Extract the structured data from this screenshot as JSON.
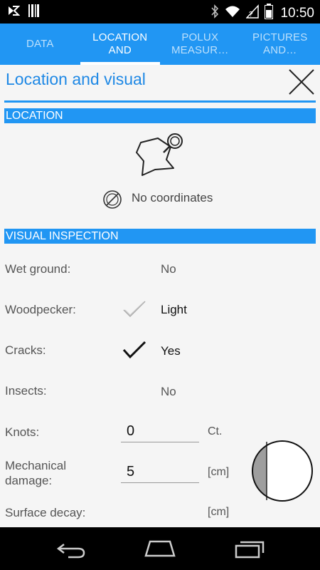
{
  "status_bar": {
    "time": "10:50",
    "left_icons": [
      "app-notification-icon",
      "barcode-icon"
    ],
    "right_icons": [
      "bluetooth-icon",
      "wifi-icon",
      "signal-icon",
      "battery-icon"
    ]
  },
  "tabs": [
    {
      "label": "DATA",
      "active": false
    },
    {
      "label": "LOCATION AND",
      "active": true
    },
    {
      "label": "POLUX MEASUR…",
      "active": false
    },
    {
      "label": "PICTURES AND…",
      "active": false
    }
  ],
  "page": {
    "title": "Location and visual"
  },
  "location": {
    "header": "LOCATION",
    "no_coordinates": "No coordinates"
  },
  "visual": {
    "header": "VISUAL INSPECTION",
    "wet_ground": {
      "label": "Wet ground:",
      "value": "No"
    },
    "woodpecker": {
      "label": "Woodpecker:",
      "value": "Light"
    },
    "cracks": {
      "label": "Cracks:",
      "value": "Yes"
    },
    "insects": {
      "label": "Insects:",
      "value": "No"
    },
    "knots": {
      "label": "Knots:",
      "value": "0",
      "unit": "Ct."
    },
    "mechanical_damage": {
      "label": "Mechanical damage:",
      "value": "5",
      "unit": "[cm]"
    },
    "surface_decay": {
      "label": "Surface decay:",
      "unit": "[cm]"
    }
  },
  "colors": {
    "accent": "#2196f3",
    "title": "#1e88e5"
  }
}
